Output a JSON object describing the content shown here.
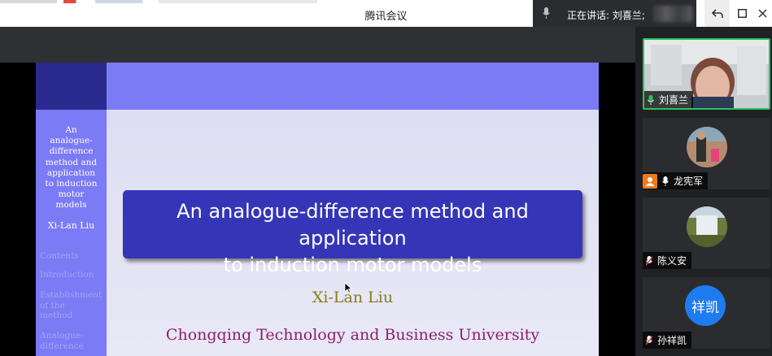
{
  "window": {
    "title": "腾讯会议",
    "speaking_label": "正在讲话: 刘喜兰;",
    "controls": {
      "undo_icon": "undo-arrow-icon",
      "maximize_icon": "maximize-icon",
      "close_icon": "close-icon"
    }
  },
  "slide": {
    "sidebar": {
      "title_lines": [
        "An",
        "analogue-",
        "difference",
        "method and",
        "application",
        "to induction",
        "motor",
        "models"
      ],
      "author": "Xi-Lan Liu",
      "nav_items": [
        {
          "label": "Contents"
        },
        {
          "label": "Introduction"
        },
        {
          "label": "Establishment\nof the\nmethod"
        },
        {
          "label": "Analogue-\ndifference"
        }
      ]
    },
    "title_line1": "An analogue-difference method and application",
    "title_line2": "to induction motor models",
    "author": "Xi-Lan Liu",
    "institution": "Chongqing Technology and Business University",
    "colors": {
      "header_blue": "#7b7bf5",
      "corner_navy": "#2a2a8e",
      "title_box": "#3535b8",
      "author": "#8a7e1a",
      "institution": "#8b1f6e",
      "background": "#e4e4f5"
    }
  },
  "participants": [
    {
      "name": "刘喜兰",
      "active": true,
      "video": "photo-elderly-woman",
      "mic": "on"
    },
    {
      "name": "龙宪军",
      "active": false,
      "video": "avatar-photo-man-child",
      "mic": "on",
      "host": true
    },
    {
      "name": "陈义安",
      "active": false,
      "video": "avatar-photo-waterfall",
      "mic": "muted"
    },
    {
      "name": "孙祥凯",
      "active": false,
      "video": "avatar-initials",
      "avatar_text": "祥凯",
      "avatar_color": "#1e7bf0",
      "mic": "muted"
    }
  ],
  "colors": {
    "active_border": "#2bc35b",
    "panel_bg": "#202124",
    "tile_bg": "#2b2c30"
  }
}
